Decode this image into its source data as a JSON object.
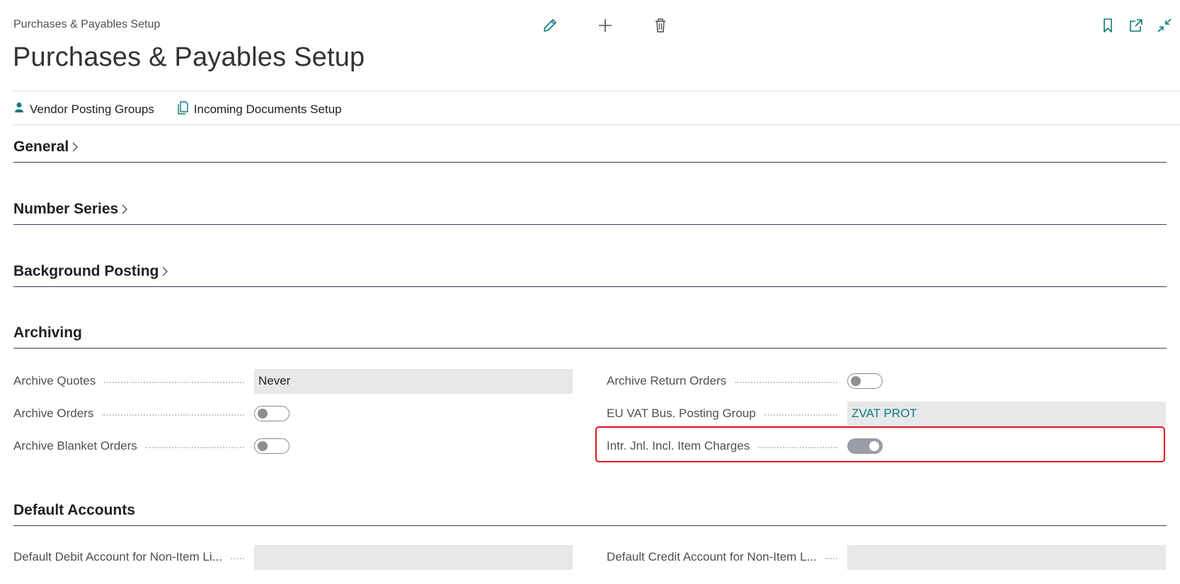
{
  "header": {
    "breadcrumb": "Purchases & Payables Setup",
    "title": "Purchases & Payables Setup",
    "toolbar_icons": [
      "pencil-icon",
      "plus-icon",
      "trash-icon"
    ],
    "right_icons": [
      "bookmark-icon",
      "open-new-window-icon",
      "collapse-icon"
    ]
  },
  "actions": [
    {
      "label": "Vendor Posting Groups",
      "icon": "person-icon"
    },
    {
      "label": "Incoming Documents Setup",
      "icon": "document-icon"
    }
  ],
  "sections": {
    "general": "General",
    "number_series": "Number Series",
    "background_posting": "Background Posting",
    "archiving": "Archiving",
    "default_accounts": "Default Accounts"
  },
  "archiving": {
    "left": [
      {
        "label": "Archive Quotes",
        "type": "select",
        "value": "Never"
      },
      {
        "label": "Archive Orders",
        "type": "toggle",
        "value": false
      },
      {
        "label": "Archive Blanket Orders",
        "type": "toggle",
        "value": false
      }
    ],
    "right": [
      {
        "label": "Archive Return Orders",
        "type": "toggle",
        "value": false
      },
      {
        "label": "EU VAT Bus. Posting Group",
        "type": "lookup",
        "value": "ZVAT PROT"
      },
      {
        "label": "Intr. Jnl. Incl. Item Charges",
        "type": "toggle",
        "value": true
      }
    ]
  },
  "default_accounts": {
    "debit_label": "Default Debit Account for Non-Item Li...",
    "debit_value": "",
    "credit_label": "Default Credit Account for Non-Item L...",
    "credit_value": ""
  },
  "colors": {
    "accent": "#0e7a7a",
    "highlight": "#e0141e"
  }
}
